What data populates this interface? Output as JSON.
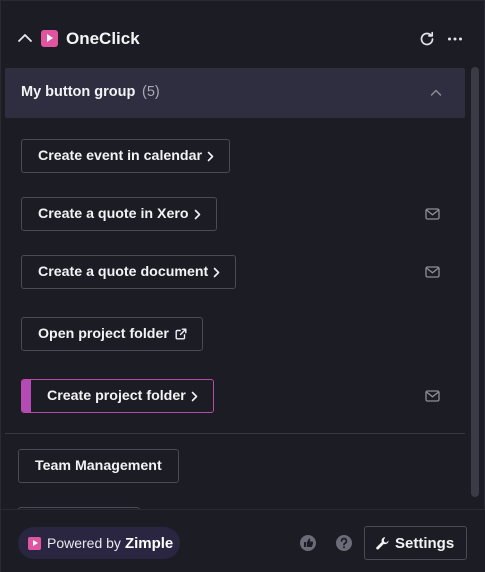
{
  "header": {
    "title": "OneClick"
  },
  "group": {
    "title": "My button group",
    "count": "(5)"
  },
  "actions": [
    {
      "label": "Create event in calendar",
      "suffix_icon": "chevron-right-icon",
      "has_mail": false,
      "selected": false
    },
    {
      "label": "Create a quote in Xero",
      "suffix_icon": "chevron-right-icon",
      "has_mail": true,
      "selected": false
    },
    {
      "label": "Create a quote document",
      "suffix_icon": "chevron-right-icon",
      "has_mail": true,
      "selected": false
    },
    {
      "label": "Open project folder",
      "suffix_icon": "external-link-icon",
      "has_mail": false,
      "selected": false
    },
    {
      "label": "Create project folder",
      "suffix_icon": "chevron-right-icon",
      "has_mail": true,
      "selected": true
    }
  ],
  "team_button": {
    "label": "Team Management"
  },
  "footer": {
    "powered_by": "Powered by",
    "brand": "Zimple",
    "settings_label": "Settings"
  },
  "colors": {
    "background": "#1c1c25",
    "group_header": "#2e2e40",
    "accent": "#b34ab6",
    "logo": "#e0559f",
    "badge": "#2a2540"
  }
}
